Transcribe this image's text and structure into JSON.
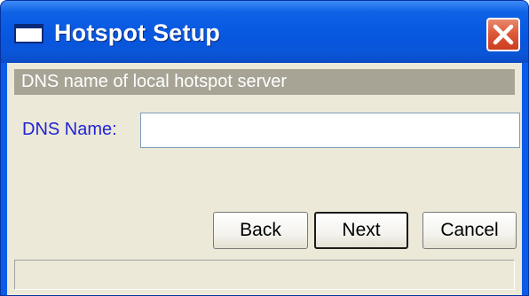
{
  "window": {
    "title": "Hotspot Setup",
    "icon": "window-icon",
    "close_icon": "close-icon"
  },
  "section": {
    "header": "DNS name of local hotspot server"
  },
  "form": {
    "dns_label": "DNS Name:",
    "dns_value": "",
    "dns_placeholder": ""
  },
  "buttons": {
    "back_label": "Back",
    "next_label": "Next",
    "cancel_label": "Cancel"
  },
  "status": {
    "text": ""
  },
  "colors": {
    "titlebar": "#0a5ce8",
    "client_bg": "#ece9d8",
    "header_bg": "#a7a496",
    "label_text": "#2323d6",
    "close_button": "#dd5a3a"
  }
}
